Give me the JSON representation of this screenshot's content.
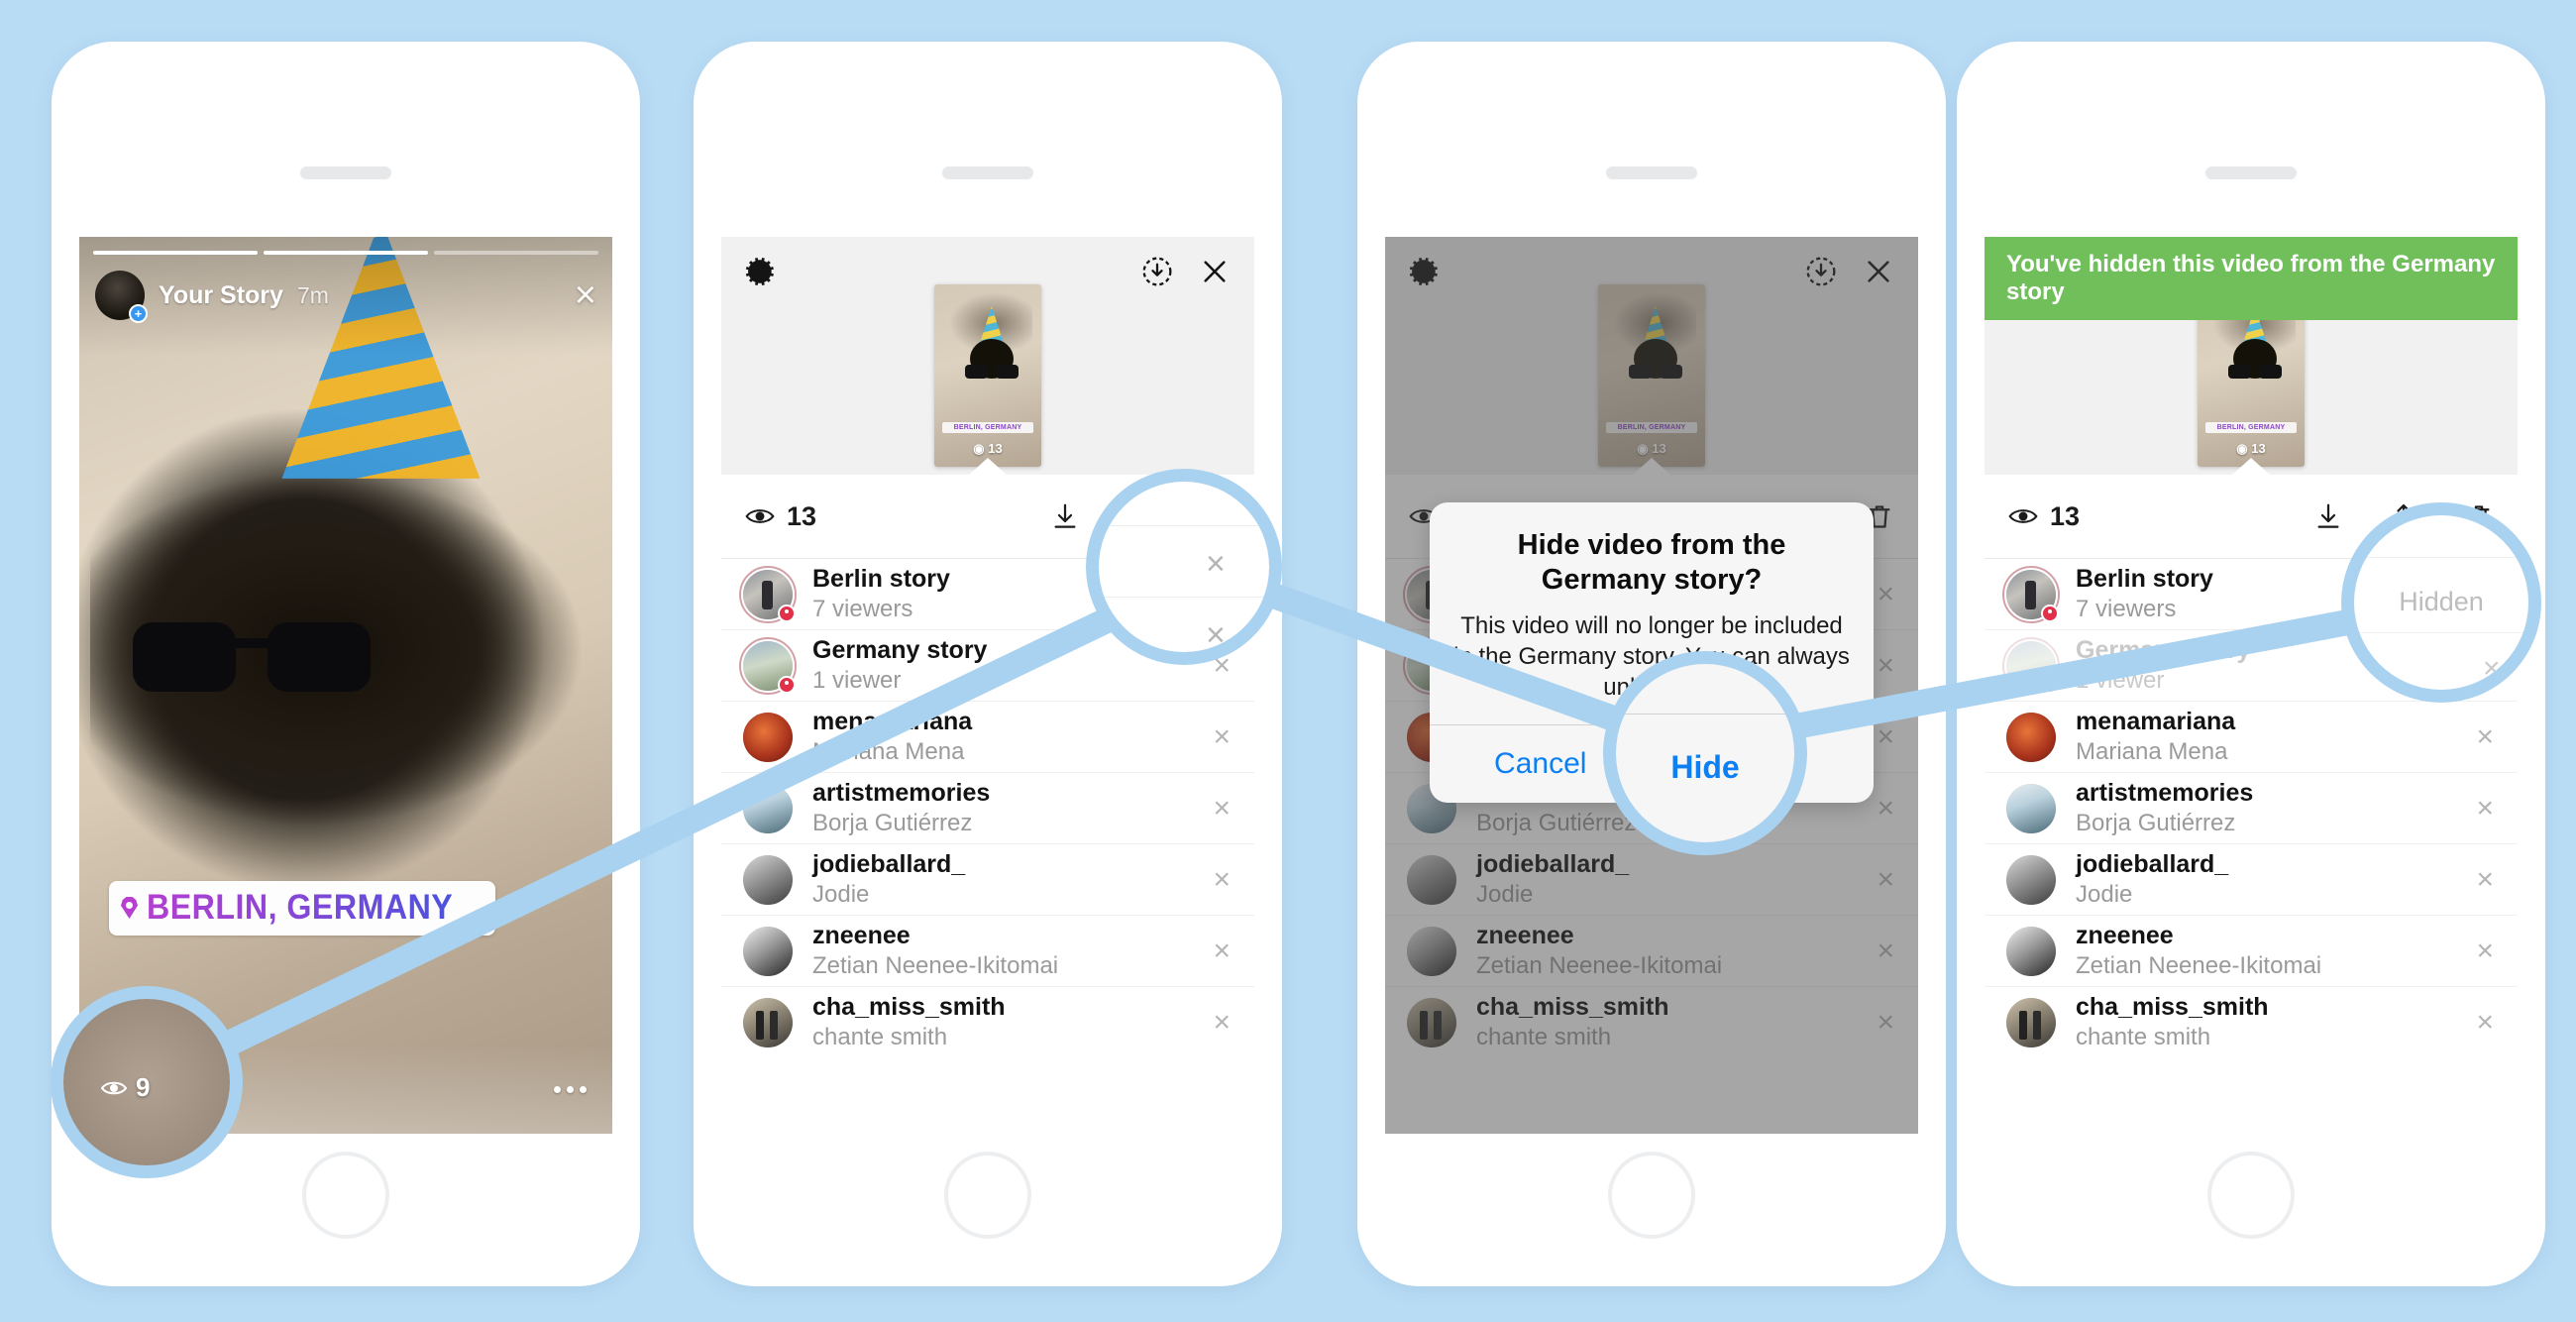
{
  "theme": {
    "page_bg": "#b9dcf5",
    "callout_blue": "#a9d2f0",
    "banner_green": "#70bf5b",
    "link_blue": "#0c7ff2",
    "accent_purple": "#b23fcf"
  },
  "phone1": {
    "story": {
      "username": "Your Story",
      "timestamp": "7m",
      "close_icon": "close-icon",
      "avatar_badge": "+",
      "progress_segments": 3,
      "progress_filled": 2,
      "location_sticker": "BERLIN, GERMANY",
      "views_count": "9",
      "eye_icon": "eye-icon",
      "more_icon": "more-options-icon"
    }
  },
  "phone2": {
    "toolbar": {
      "settings_icon": "gear-icon",
      "save_icon": "download-circle-icon",
      "close_icon": "close-icon"
    },
    "thumbnail": {
      "location_label": "BERLIN, GERMANY",
      "views": "13"
    },
    "stats": {
      "eye_icon": "eye-icon",
      "views": "13",
      "download_icon": "download-icon",
      "share_icon": "share-icon",
      "delete_icon": "trash-icon"
    },
    "rows": [
      {
        "title": "Berlin story",
        "sub": "7 viewers",
        "avatar": "a-berlin",
        "ring": true,
        "geo": true,
        "action": "×"
      },
      {
        "title": "Germany story",
        "sub": "1 viewer",
        "avatar": "a-germany",
        "ring": true,
        "geo": true,
        "action": "×"
      },
      {
        "title": "menamariana",
        "sub": "Mariana Mena",
        "avatar": "a-mena",
        "ring": false,
        "geo": false,
        "action": "×"
      },
      {
        "title": "artistmemories",
        "sub": "Borja Gutiérrez",
        "avatar": "a-artist",
        "ring": false,
        "geo": false,
        "action": "×"
      },
      {
        "title": "jodieballard_",
        "sub": "Jodie",
        "avatar": "a-jodie",
        "ring": false,
        "geo": false,
        "action": "×"
      },
      {
        "title": "zneenee",
        "sub": "Zetian Neenee-Ikitomai",
        "avatar": "a-zneenee",
        "ring": false,
        "geo": false,
        "action": "×"
      },
      {
        "title": "cha_miss_smith",
        "sub": "chante smith",
        "avatar": "a-cha",
        "ring": false,
        "geo": false,
        "action": "×"
      }
    ]
  },
  "phone3": {
    "alert": {
      "title": "Hide video from the Germany story?",
      "message": "This video will no longer be included in the Germany story. You can always unhide it.",
      "cancel_label": "Cancel",
      "confirm_label": "Hide"
    }
  },
  "phone4": {
    "banner": "You've hidden this video from the Germany story",
    "hidden_label": "Hidden",
    "rows": [
      {
        "title": "Berlin story",
        "sub": "7 viewers",
        "avatar": "a-berlin",
        "ring": true,
        "geo": true,
        "action": "×",
        "dim": false
      },
      {
        "title": "Germany story",
        "sub": "1 viewer",
        "avatar": "a-germany",
        "ring": true,
        "geo": true,
        "action": "Hidden",
        "dim": true
      },
      {
        "title": "menamariana",
        "sub": "Mariana Mena",
        "avatar": "a-mena",
        "ring": false,
        "geo": false,
        "action": "×",
        "dim": false
      },
      {
        "title": "artistmemories",
        "sub": "Borja Gutiérrez",
        "avatar": "a-artist",
        "ring": false,
        "geo": false,
        "action": "×",
        "dim": false
      },
      {
        "title": "jodieballard_",
        "sub": "Jodie",
        "avatar": "a-jodie",
        "ring": false,
        "geo": false,
        "action": "×",
        "dim": false
      },
      {
        "title": "zneenee",
        "sub": "Zetian Neenee-Ikitomai",
        "avatar": "a-zneenee",
        "ring": false,
        "geo": false,
        "action": "×",
        "dim": false
      },
      {
        "title": "cha_miss_smith",
        "sub": "chante smith",
        "avatar": "a-cha",
        "ring": false,
        "geo": false,
        "action": "×",
        "dim": false
      }
    ]
  }
}
